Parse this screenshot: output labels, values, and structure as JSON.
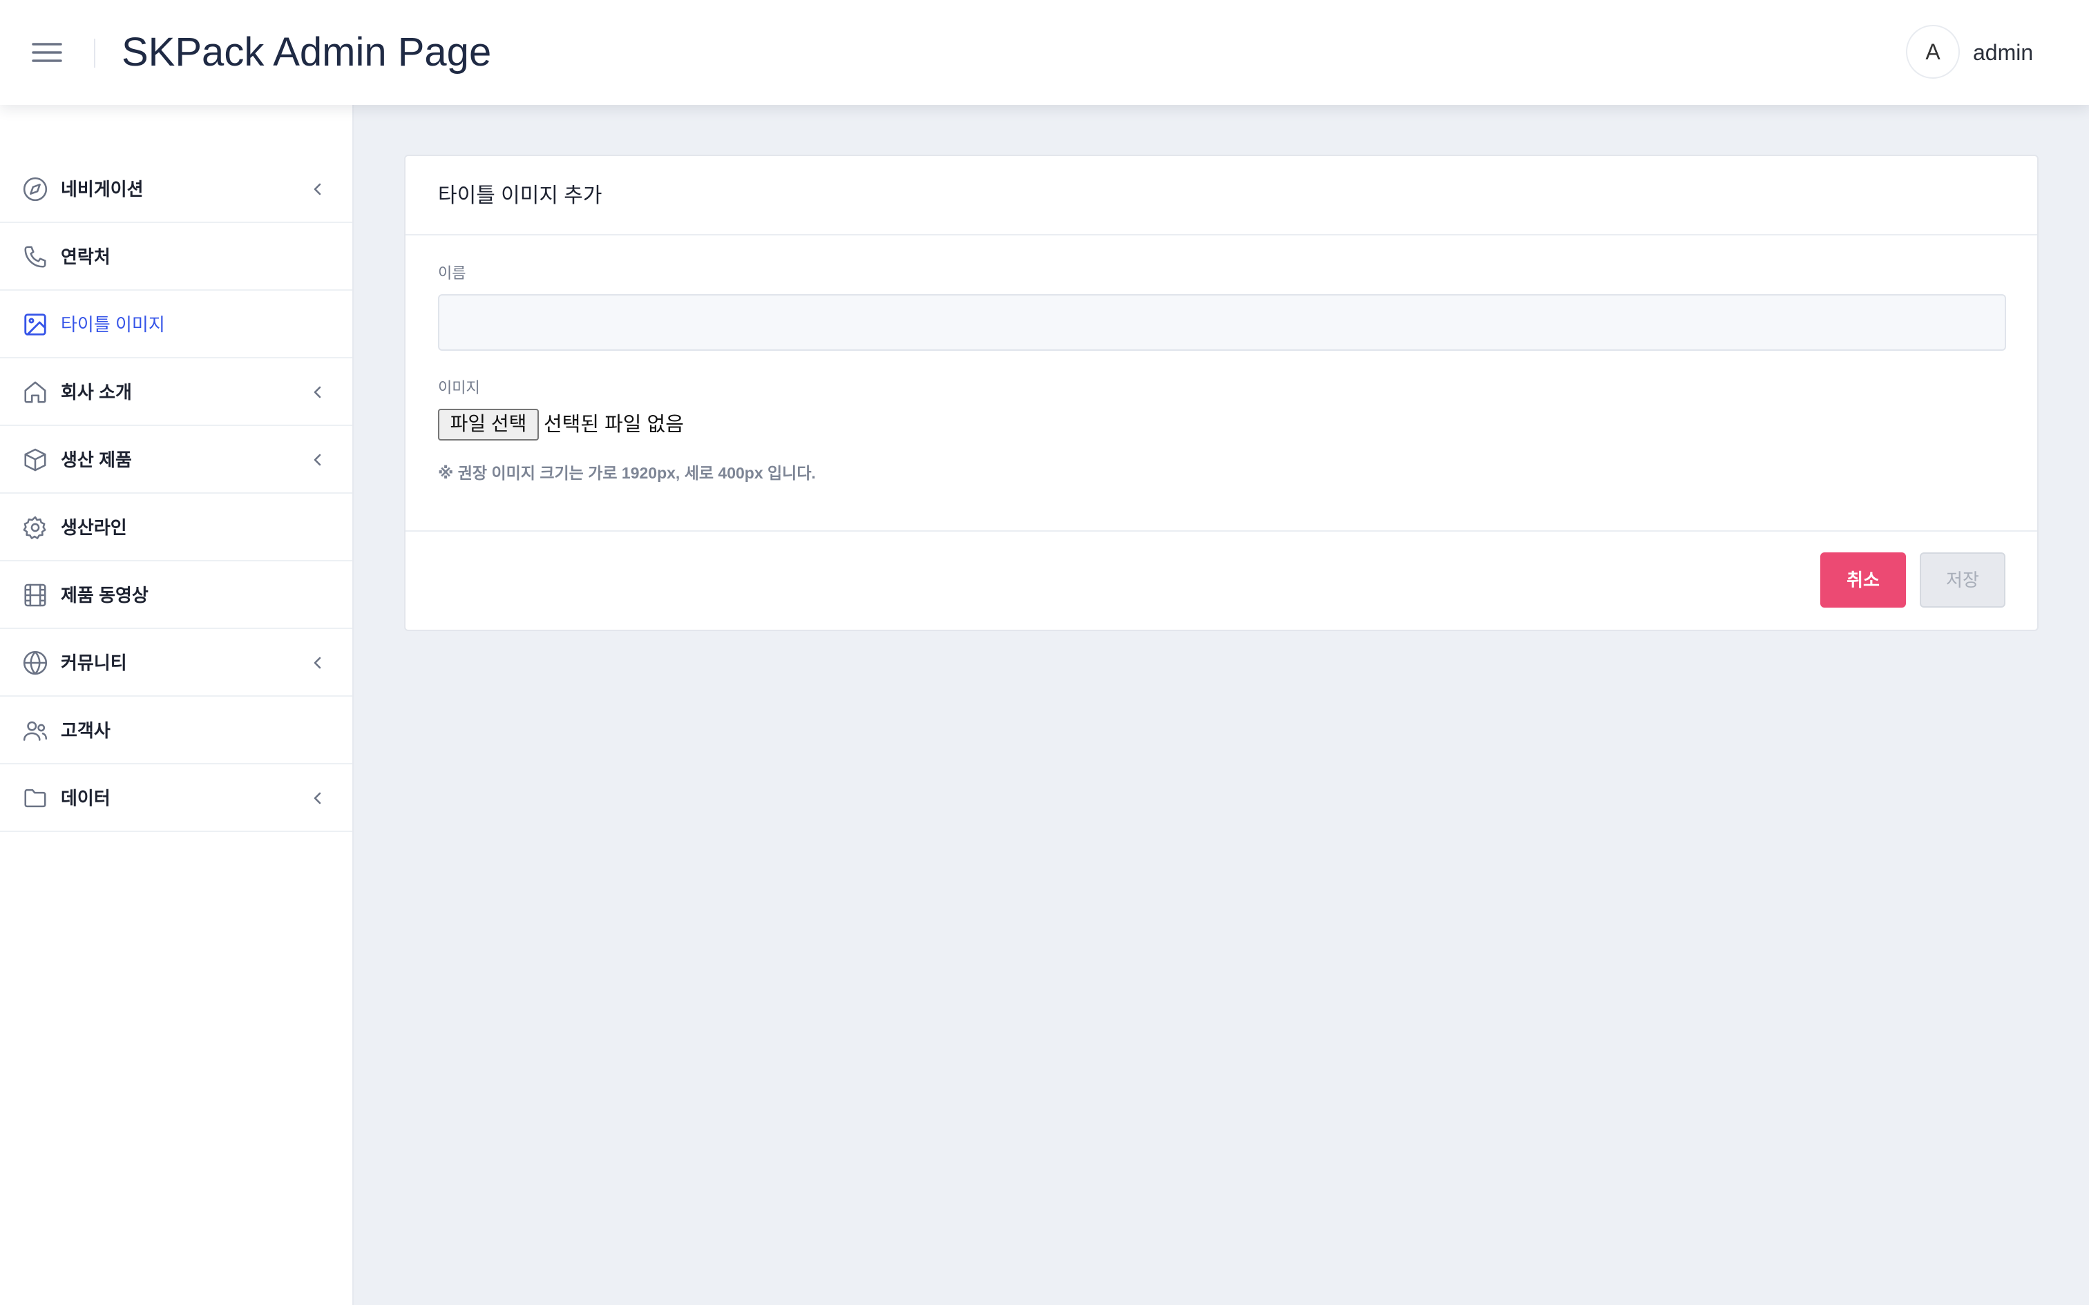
{
  "header": {
    "title": "SKPack Admin Page",
    "avatar_initial": "A",
    "username": "admin"
  },
  "sidebar": {
    "items": [
      {
        "label": "네비게이션",
        "icon": "compass-icon",
        "expandable": true
      },
      {
        "label": "연락처",
        "icon": "phone-icon",
        "expandable": false
      },
      {
        "label": "타이틀 이미지",
        "icon": "image-icon",
        "expandable": false,
        "active": true
      },
      {
        "label": "회사 소개",
        "icon": "home-icon",
        "expandable": true
      },
      {
        "label": "생산 제품",
        "icon": "box-icon",
        "expandable": true
      },
      {
        "label": "생산라인",
        "icon": "gear-icon",
        "expandable": false
      },
      {
        "label": "제품 동영상",
        "icon": "film-icon",
        "expandable": false
      },
      {
        "label": "커뮤니티",
        "icon": "globe-icon",
        "expandable": true
      },
      {
        "label": "고객사",
        "icon": "users-icon",
        "expandable": false
      },
      {
        "label": "데이터",
        "icon": "folder-icon",
        "expandable": true
      }
    ]
  },
  "form": {
    "title": "타이틀 이미지 추가",
    "name_label": "이름",
    "name_value": "",
    "image_label": "이미지",
    "file_button": "파일 선택",
    "file_status": "선택된 파일 없음",
    "hint": "※ 권장 이미지 크기는 가로 1920px, 세로 400px 입니다.",
    "cancel_label": "취소",
    "save_label": "저장"
  },
  "colors": {
    "accent": "#3554e8",
    "danger": "#ec4a73",
    "background": "#edf0f5"
  }
}
